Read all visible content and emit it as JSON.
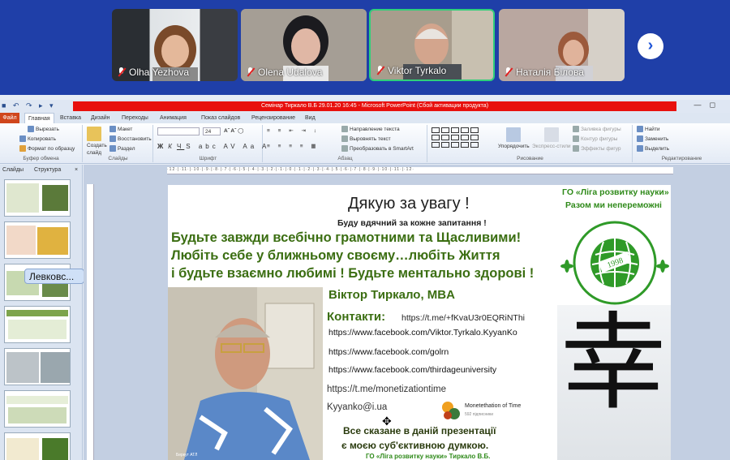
{
  "conference": {
    "participants": [
      {
        "name": "Olha Yezhova",
        "muted": true
      },
      {
        "name": "Olena Udalova",
        "muted": true
      },
      {
        "name": "Viktor Tyrkalo",
        "muted": true,
        "active": true
      },
      {
        "name": "Наталія Білова",
        "muted": true
      }
    ],
    "next_icon": "chevron-right-icon",
    "colors": {
      "bg": "#1f3fa8",
      "active_border": "#2fd07a"
    }
  },
  "powerpoint": {
    "title": "Семінар Тиркало В.Б 29.01.20 16:45 - Microsoft PowerPoint (Сбой активации продукта)",
    "tabs": [
      "Файл",
      "Главная",
      "Вставка",
      "Дизайн",
      "Переходы",
      "Анимация",
      "Показ слайдов",
      "Рецензирование",
      "Вид"
    ],
    "selected_tab": "Главная",
    "ribbon": {
      "clipboard": {
        "cut": "Вырезать",
        "copy": "Копировать",
        "format": "Формат по образцу",
        "group": "Буфер обмена"
      },
      "slides": {
        "create": "Создать",
        "create2": "слайд",
        "layout": "Макет",
        "reset": "Восстановить",
        "section": "Раздел",
        "group": "Слайды"
      },
      "font": {
        "size": "24",
        "group": "Шрифт"
      },
      "paragraph": {
        "direction": "Направление текста",
        "align": "Выровнять текст",
        "smartart": "Преобразовать в SmartArt",
        "group": "Абзац"
      },
      "drawing": {
        "arrange": "Упорядочить",
        "styles": "Экспресс-стили",
        "fill": "Заливка фигуры",
        "outline": "Контур фигуры",
        "effects": "Эффекты фигур",
        "group": "Рисование"
      },
      "editing": {
        "find": "Найти",
        "replace": "Заменить",
        "select": "Выделить",
        "group": "Редактирование"
      }
    },
    "panel": {
      "tab_slides": "Слайды",
      "tab_outline": "Структура",
      "tooltip": "Левковс...",
      "slide_numbers": [
        "",
        "",
        "",
        "",
        "",
        "",
        ""
      ]
    }
  },
  "slide": {
    "thanks": "Дякую за увагу !",
    "ask": "Буду вдячний за кожне запитання !",
    "line1": "Будьте завжди всебічно грамотними та Щасливими!",
    "line2": "Любіть себе у ближньому своєму…любіть Життя",
    "line3": "і будьте взаємно любимі ! Будьте ментально здорові !",
    "org": "ГО «Ліга розвитку науки»",
    "org_motto": "Разом ми непереможні",
    "logo_text_top": "LEAGUE OF SCIENCE DEVELOPMENT",
    "logo_year": "1998",
    "logo_text_bottom": "ГО ЛІГА РОЗВИТКУ НАУКИ",
    "name": "Віктор Тиркало, MBA",
    "contacts_label": "Контакти:",
    "telegram": "https://t.me/+fKvaU3r0EQRiNThi",
    "facebook1": "https://www.facebook.com/Viktor.Tyrkalo.KyyanKo",
    "facebook2": "https://www.facebook.com/golrn",
    "facebook3": "https://www.facebook.com/thirdageuniversity",
    "telegram2": "https://t.me/monetizationtime",
    "email": "Kyyanko@i.ua",
    "channel_name": "Monetethation of Time",
    "channel_subs": "592 підписники",
    "opinion1": "Все сказане в даній презентації",
    "opinion2": "є моєю суб'єктивною думкою.",
    "footer": "ГО «Ліга розвитку науки»      Тиркало В.Б.",
    "kanji": "幸",
    "photo_caption": "Беркут АТЛ"
  }
}
